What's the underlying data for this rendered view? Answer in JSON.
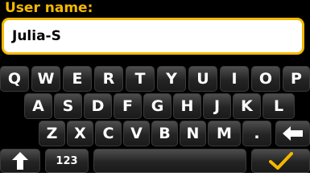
{
  "header": {
    "title": "User name:"
  },
  "input": {
    "value": "Julia-S"
  },
  "keyboard": {
    "row1": [
      "Q",
      "W",
      "E",
      "R",
      "T",
      "Y",
      "U",
      "I",
      "O",
      "P"
    ],
    "row2": [
      "A",
      "S",
      "D",
      "F",
      "G",
      "H",
      "J",
      "K",
      "L"
    ],
    "row3": [
      "Z",
      "X",
      "C",
      "V",
      "B",
      "N",
      "M",
      "."
    ],
    "numbers_label": "123"
  },
  "icons": {
    "shift": "up-arrow-icon",
    "backspace": "left-arrow-icon",
    "confirm": "checkmark-icon"
  },
  "colors": {
    "accent": "#f5b800",
    "background": "#000000",
    "field_background": "#ffffff",
    "key_text": "#ffffff"
  }
}
